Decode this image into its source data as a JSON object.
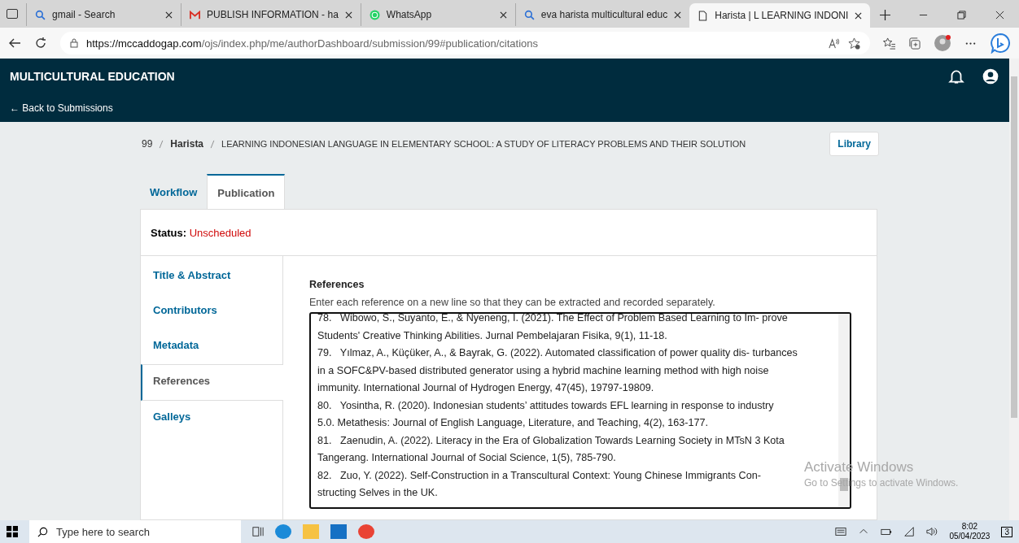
{
  "browser": {
    "tabs": [
      {
        "kind": "search",
        "title": "gmail - Search",
        "selected": false
      },
      {
        "kind": "gmail",
        "title": "PUBLISH INFORMATION - ha",
        "selected": false
      },
      {
        "kind": "whatsapp",
        "title": "WhatsApp",
        "selected": false
      },
      {
        "kind": "search",
        "title": "eva harista multicultural educ",
        "selected": false
      },
      {
        "kind": "page",
        "title": "Harista | L LEARNING INDONI",
        "selected": true
      }
    ],
    "url_host": "https://mccaddogap.com",
    "url_path": "/ojs/index.php/me/authorDashboard/submission/99#publication/citations"
  },
  "header": {
    "site_title": "MULTICULTURAL EDUCATION",
    "back_link": "← Back to Submissions"
  },
  "breadcrumb": {
    "id": "99",
    "author": "Harista",
    "title": "LEARNING INDONESIAN LANGUAGE IN ELEMENTARY SCHOOL: A STUDY OF LITERACY PROBLEMS AND THEIR SOLUTION",
    "library_button": "Library"
  },
  "tabs": [
    {
      "label": "Workflow",
      "selected": false
    },
    {
      "label": "Publication",
      "selected": true
    }
  ],
  "status": {
    "label": "Status:",
    "value": "Unscheduled"
  },
  "nav": [
    {
      "label": "Title & Abstract",
      "selected": false
    },
    {
      "label": "Contributors",
      "selected": false
    },
    {
      "label": "Metadata",
      "selected": false
    },
    {
      "label": "References",
      "selected": true
    },
    {
      "label": "Galleys",
      "selected": false
    }
  ],
  "references": {
    "label": "References",
    "description": "Enter each reference on a new line so that they can be extracted and recorded separately.",
    "lines": [
      "78.   Wibowo, S., Suyanto, E., & Nyeneng, I. (2021). The Effect of Problem Based Learning to Im- prove",
      "Students' Creative Thinking Abilities. Jurnal Pembelajaran Fisika, 9(1), 11-18.",
      "79.   Yılmaz, A., Küçüker, A., & Bayrak, G. (2022). Automated classification of power quality dis- turbances",
      "in a SOFC&PV-based distributed generator using a hybrid machine learning method with high noise",
      "immunity. International Journal of Hydrogen Energy, 47(45), 19797-19809.",
      "80.   Yosintha, R. (2020). Indonesian students’ attitudes towards EFL learning in response to industry",
      "5.0. Metathesis: Journal of English Language, Literature, and Teaching, 4(2), 163-177.",
      "81.   Zaenudin, A. (2022). Literacy in the Era of Globalization Towards Learning Society in MTsN 3 Kota",
      "Tangerang. International Journal of Social Science, 1(5), 785-790.",
      "82.   Zuo, Y. (2022). Self-Construction in a Transcultural Context: Young Chinese Immigrants Con-",
      "structing Selves in the UK."
    ]
  },
  "activation": {
    "title": "Activate Windows",
    "subtitle": "Go to Settings to activate Windows."
  },
  "taskbar": {
    "search_placeholder": "Type here to search",
    "time": "8:02",
    "date": "05/04/2023",
    "notification_count": "3"
  }
}
